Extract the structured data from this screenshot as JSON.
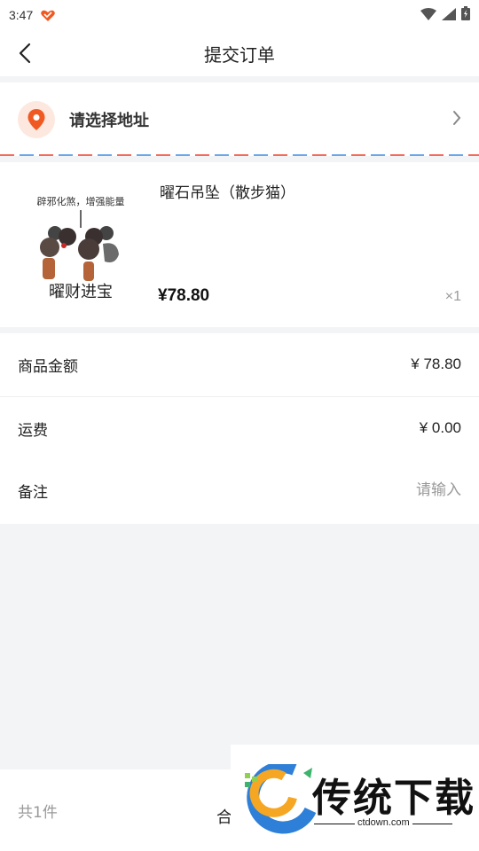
{
  "status_bar": {
    "time": "3:47"
  },
  "nav": {
    "title": "提交订单"
  },
  "address": {
    "placeholder_text": "请选择地址"
  },
  "product": {
    "name": "曜石吊坠（散步猫）",
    "price": "¥78.80",
    "quantity": "×1",
    "image_text": {
      "top": "辟邪化煞，增强能量",
      "bottom": "曜财进宝"
    }
  },
  "summary": {
    "goods_amount_label": "商品金额",
    "goods_amount_value": "¥ 78.80",
    "shipping_label": "运费",
    "shipping_value": "¥ 0.00",
    "remark_label": "备注",
    "remark_placeholder": "请输入"
  },
  "footer": {
    "item_count": "共1件",
    "total_label": "合"
  },
  "watermark": {
    "name": "传统下载",
    "url": "ctdown.com"
  },
  "colors": {
    "accent": "#f05a22",
    "envelope_red": "#f26a5a",
    "envelope_blue": "#6aa6e8"
  }
}
